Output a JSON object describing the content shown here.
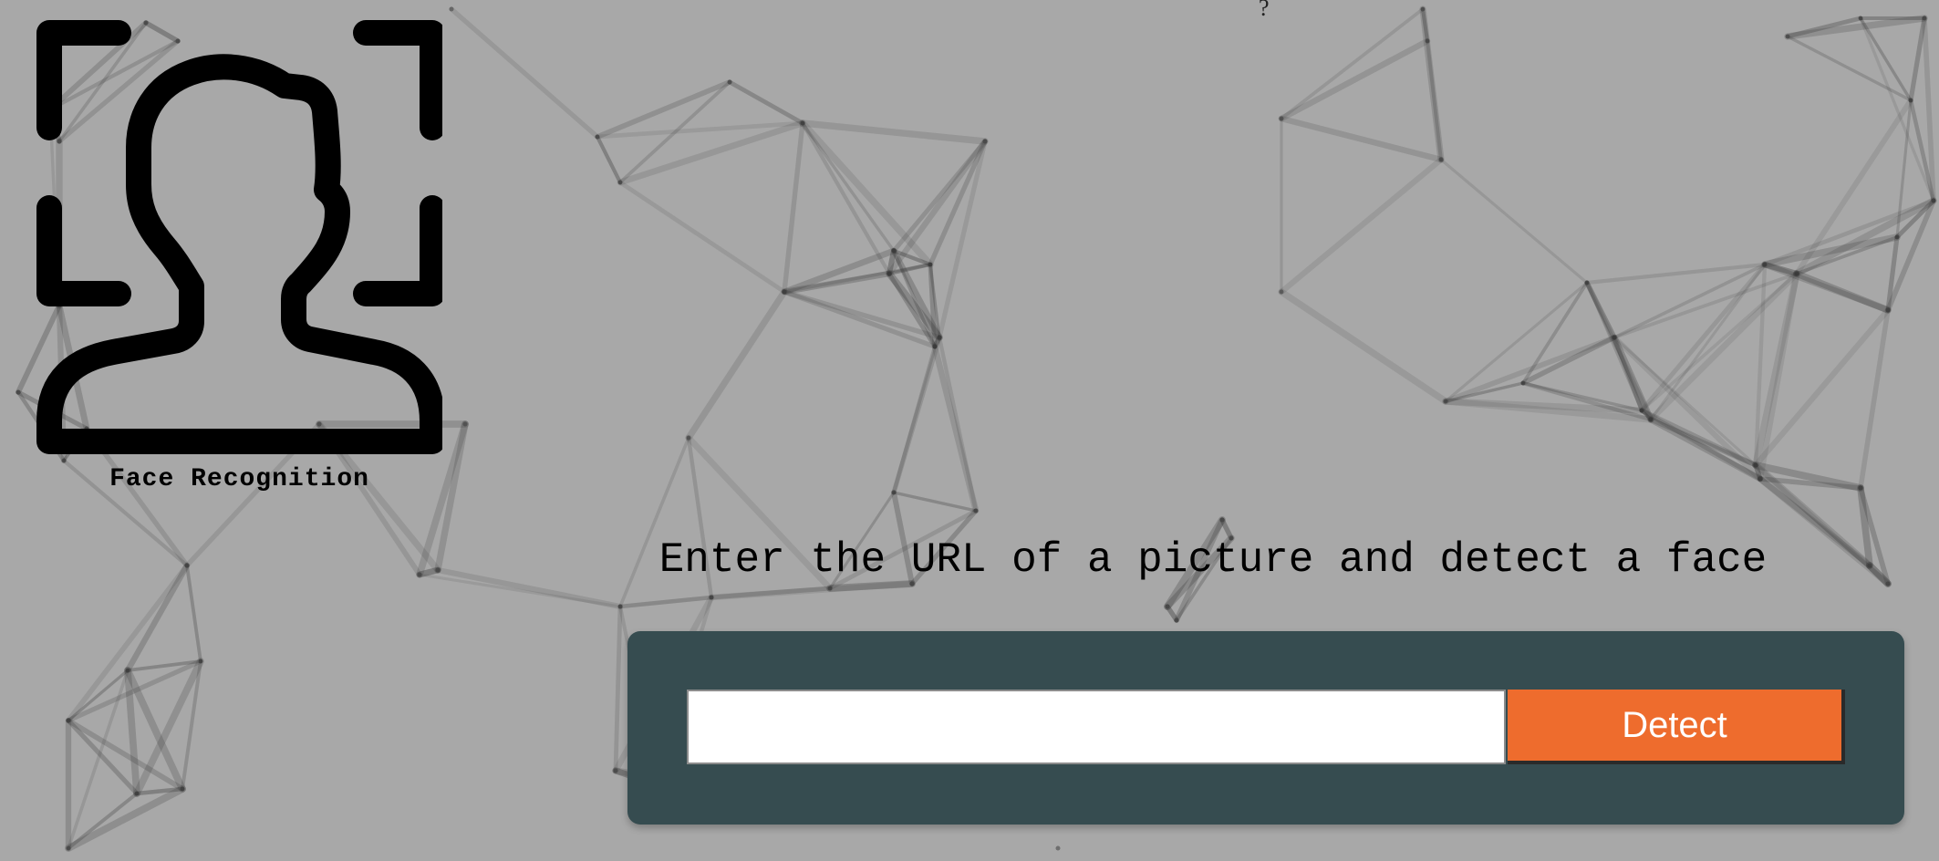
{
  "logo": {
    "label": "Face Recognition",
    "icon": "face-recognition-icon"
  },
  "header": {
    "glyph": "?"
  },
  "form": {
    "prompt": "Enter the URL of a picture and detect a face",
    "url_placeholder": "",
    "url_value": "",
    "detect_label": "Detect"
  },
  "colors": {
    "background": "#a8a8a8",
    "panel": "#364c50",
    "button": "#ee6c2d",
    "button_text": "#ffffff"
  }
}
